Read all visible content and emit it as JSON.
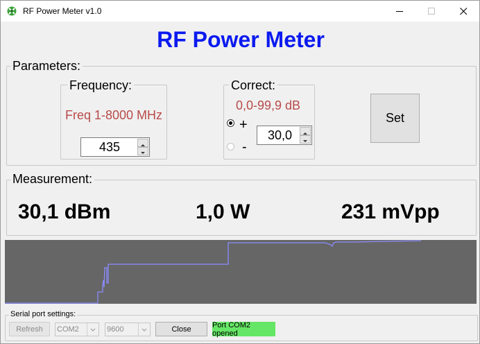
{
  "window": {
    "title": "RF Power Meter v1.0",
    "icon": "rf-meter-app-icon",
    "controls": [
      "minimize-icon",
      "maximize-icon",
      "close-icon"
    ]
  },
  "header": {
    "title": "RF Power Meter",
    "color": "#0a1af0"
  },
  "parameters": {
    "label": "Parameters:",
    "frequency": {
      "label": "Frequency:",
      "range_text": "Freq 1-8000 MHz",
      "value": "435"
    },
    "correct": {
      "label": "Correct:",
      "range_text": "0,0-99,9 dB",
      "plus_label": "+",
      "minus_label": "-",
      "selected": "+",
      "value": "30,0"
    },
    "set_button": "Set"
  },
  "measurement": {
    "label": "Measurement:",
    "dbm": "30,1 dBm",
    "watts": "1,0 W",
    "mvpp": "231 mVpp"
  },
  "plot": {
    "background": "#666666",
    "line_color": "#8c8cff"
  },
  "serial": {
    "label": "Serial port settings:",
    "refresh_button": "Refresh",
    "port": "COM2",
    "baud": "9600",
    "close_button": "Close",
    "status": "Port COM2 opened",
    "status_color": "#66e666"
  }
}
